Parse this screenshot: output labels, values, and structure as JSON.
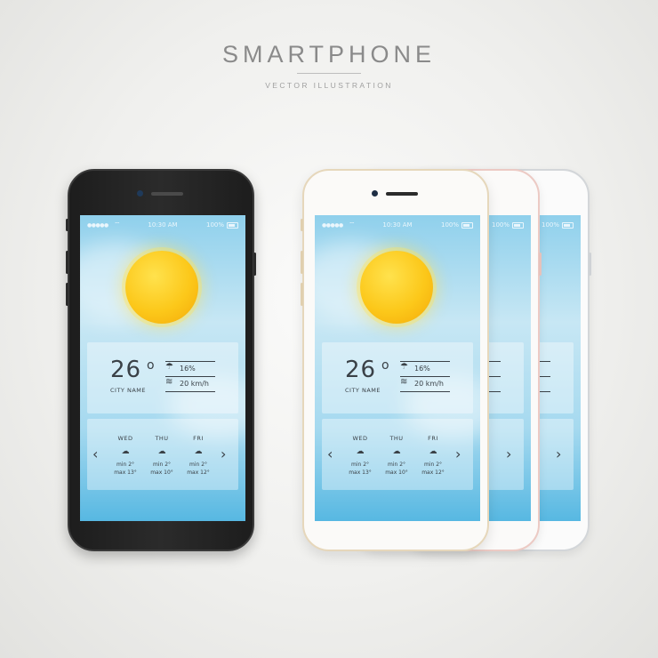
{
  "header": {
    "title": "SMARTPHONE",
    "subtitle": "VECTOR ILLUSTRATION"
  },
  "status_bar": {
    "signal": "●●●●●",
    "time": "10:30 AM",
    "battery": "100%"
  },
  "weather": {
    "temperature": "26",
    "degree_symbol": "o",
    "city": "CITY NAME",
    "humidity": "16%",
    "wind": "20 km/h",
    "icons": {
      "humidity": "umbrella-icon",
      "wind": "wind-icon",
      "sun": "sun-icon"
    }
  },
  "forecast": {
    "prev": "‹",
    "next": "›",
    "days": [
      {
        "name": "WED",
        "icon": "cloud-icon",
        "min": "min  2°",
        "max": "max  13°"
      },
      {
        "name": "THU",
        "icon": "rain-cloud-icon",
        "min": "min  2°",
        "max": "max  10°"
      },
      {
        "name": "FRI",
        "icon": "rain-cloud-icon",
        "min": "min  2°",
        "max": "max  12°"
      }
    ]
  },
  "colors": {
    "black_phone": "#1f1f1f",
    "gold_trim": "#e6d7bb",
    "rose_trim": "#eccac4",
    "silver_trim": "#d3d6d9",
    "sky": "#8fd0ec",
    "sun": "#fcc81a"
  }
}
